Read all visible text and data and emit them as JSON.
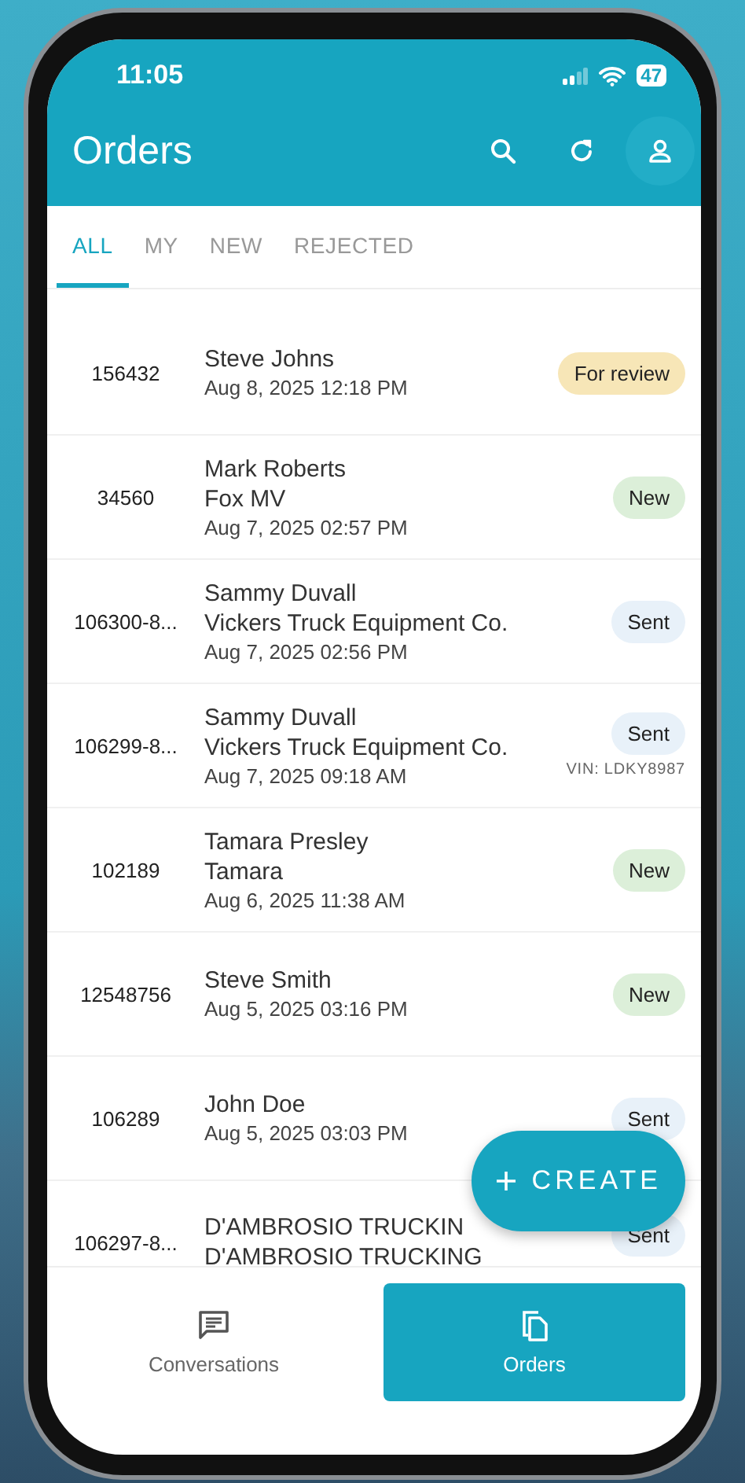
{
  "status_bar": {
    "time": "11:05",
    "battery": "47"
  },
  "header": {
    "title": "Orders"
  },
  "tabs": [
    {
      "label": "ALL",
      "selected": true
    },
    {
      "label": "MY",
      "selected": false
    },
    {
      "label": "NEW",
      "selected": false
    },
    {
      "label": "REJECTED",
      "selected": false
    }
  ],
  "orders": [
    {
      "number": "156432",
      "lines": [
        "Steve Johns"
      ],
      "date": "Aug 8, 2025 12:18 PM",
      "status": {
        "label": "For review",
        "kind": "review"
      }
    },
    {
      "number": "34560",
      "lines": [
        "Mark Roberts",
        "Fox MV"
      ],
      "date": "Aug 7, 2025 02:57 PM",
      "status": {
        "label": "New",
        "kind": "new"
      }
    },
    {
      "number": "106300-8...",
      "lines": [
        "Sammy Duvall",
        "Vickers Truck Equipment Co."
      ],
      "date": "Aug 7, 2025 02:56 PM",
      "status": {
        "label": "Sent",
        "kind": "sent"
      }
    },
    {
      "number": "106299-8...",
      "lines": [
        "Sammy Duvall",
        "Vickers Truck Equipment Co."
      ],
      "date": "Aug 7, 2025 09:18 AM",
      "status": {
        "label": "Sent",
        "kind": "sent"
      },
      "vin": "VIN: LDKY8987"
    },
    {
      "number": "102189",
      "lines": [
        "Tamara Presley",
        "Tamara"
      ],
      "date": "Aug 6, 2025 11:38 AM",
      "status": {
        "label": "New",
        "kind": "new"
      }
    },
    {
      "number": "12548756",
      "lines": [
        "Steve Smith"
      ],
      "date": "Aug 5, 2025 03:16 PM",
      "status": {
        "label": "New",
        "kind": "new"
      }
    },
    {
      "number": "106289",
      "lines": [
        "John Doe"
      ],
      "date": "Aug 5, 2025 03:03 PM",
      "status": {
        "label": "Sent",
        "kind": "sent"
      }
    },
    {
      "number": "106297-8...",
      "lines": [
        "D'AMBROSIO TRUCKIN",
        "D'AMBROSIO TRUCKING"
      ],
      "status": {
        "label": "Sent",
        "kind": "sent"
      }
    }
  ],
  "fab": {
    "label": "CREATE"
  },
  "bottom_nav": [
    {
      "label": "Conversations",
      "selected": false
    },
    {
      "label": "Orders",
      "selected": true
    }
  ]
}
